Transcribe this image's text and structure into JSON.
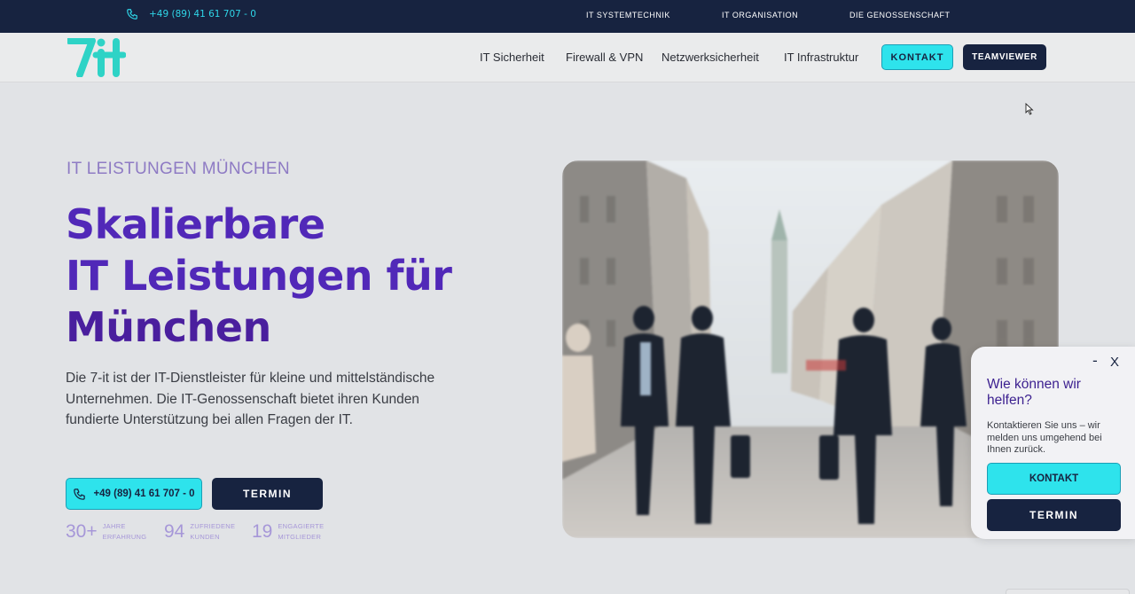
{
  "topbar": {
    "phone": "+49 (89) 41 61 707 - 0",
    "links": [
      "IT SYSTEMTECHNIK",
      "IT ORGANISATION",
      "DIE GENOSSENSCHAFT"
    ]
  },
  "header": {
    "logo_text": "7it",
    "nav": [
      "IT Sicherheit",
      "Firewall & VPN",
      "Netzwerksicherheit",
      "IT Infrastruktur"
    ],
    "kontakt_label": "KONTAKT",
    "teamviewer_label": "TEAMVIEWER"
  },
  "hero": {
    "eyebrow": "IT LEISTUNGEN MÜNCHEN",
    "title_lines": [
      "Skalierbare",
      "IT Leistungen für",
      "München"
    ],
    "description": "Die 7-it ist der IT-Dienstleister für kleine und mittelständische Unternehmen. Die IT-Genossenschaft bietet ihren Kunden fundierte Unterstützung bei allen Fragen der IT.",
    "phone_button": "+49 (89) 41 61 707 - 0",
    "termin_button": "TERMIN",
    "stats": [
      {
        "value": "30+",
        "label": "JAHRE ERFAHRUNG"
      },
      {
        "value": "94",
        "label": "ZUFRIEDENE KUNDEN"
      },
      {
        "value": "19",
        "label": "ENGAGIERTE MITGLIEDER"
      }
    ]
  },
  "chat": {
    "minimize": "-",
    "close": "X",
    "title": "Wie können wir helfen?",
    "text": "Kontaktieren Sie uns – wir melden uns umgehend bei Ihnen zurück.",
    "kontakt_label": "KONTAKT",
    "termin_label": "TERMIN"
  },
  "colors": {
    "navy": "#172340",
    "cyan": "#2ee3ec",
    "purple": "#5128b8",
    "lavender": "#a697d8"
  },
  "icons": [
    "phone-icon",
    "logo-icon",
    "cursor-icon"
  ]
}
